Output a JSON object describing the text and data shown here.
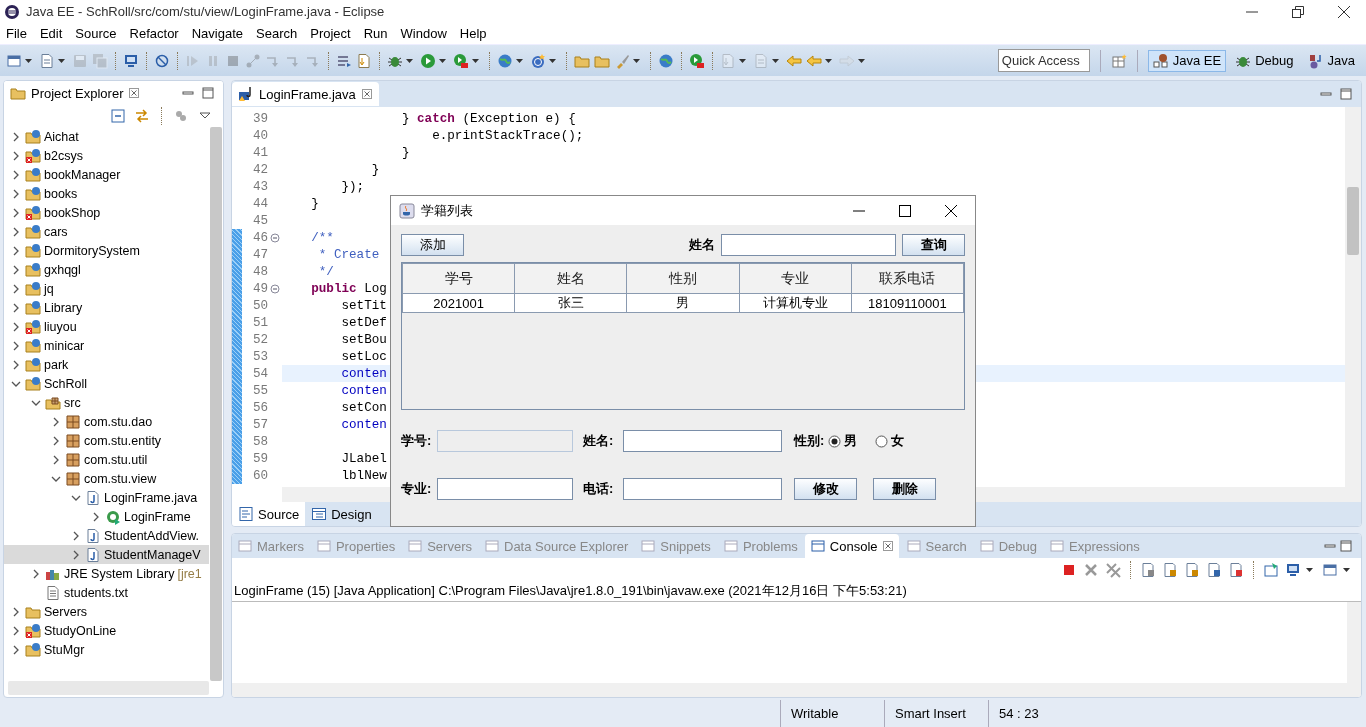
{
  "window": {
    "title": "Java EE - SchRoll/src/com/stu/view/LoginFrame.java - Eclipse"
  },
  "menu": [
    "File",
    "Edit",
    "Source",
    "Refactor",
    "Navigate",
    "Search",
    "Project",
    "Run",
    "Window",
    "Help"
  ],
  "toolbar": [
    {
      "kind": "window",
      "disabled": false,
      "dropdown": true
    },
    {
      "kind": "doc",
      "disabled": false,
      "dropdown": true
    },
    {
      "kind": "save",
      "disabled": true,
      "dropdown": false
    },
    {
      "kind": "saves",
      "disabled": true,
      "dropdown": false
    },
    {
      "kind": "sep"
    },
    {
      "kind": "monitor",
      "disabled": false,
      "dropdown": false
    },
    {
      "kind": "sep"
    },
    {
      "kind": "nosign",
      "disabled": false,
      "dropdown": false
    },
    {
      "kind": "sep"
    },
    {
      "kind": "play",
      "disabled": true,
      "dropdown": false
    },
    {
      "kind": "pause",
      "disabled": true,
      "dropdown": false
    },
    {
      "kind": "stop",
      "disabled": true,
      "dropdown": false
    },
    {
      "kind": "nodes",
      "disabled": true,
      "dropdown": false
    },
    {
      "kind": "step",
      "disabled": true,
      "dropdown": false
    },
    {
      "kind": "step",
      "disabled": true,
      "dropdown": false
    },
    {
      "kind": "step",
      "disabled": true,
      "dropdown": false
    },
    {
      "kind": "sep"
    },
    {
      "kind": "list",
      "disabled": false,
      "dropdown": false
    },
    {
      "kind": "docarrow",
      "disabled": false,
      "dropdown": false
    },
    {
      "kind": "sep"
    },
    {
      "kind": "bug",
      "disabled": false,
      "dropdown": true
    },
    {
      "kind": "run",
      "disabled": false,
      "dropdown": true
    },
    {
      "kind": "runserver",
      "disabled": false,
      "dropdown": true
    },
    {
      "kind": "sep"
    },
    {
      "kind": "globe",
      "disabled": false,
      "dropdown": true
    },
    {
      "kind": "coin",
      "disabled": false,
      "dropdown": true
    },
    {
      "kind": "sep"
    },
    {
      "kind": "folder",
      "disabled": false,
      "dropdown": false
    },
    {
      "kind": "folder",
      "disabled": false,
      "dropdown": false
    },
    {
      "kind": "brush",
      "disabled": false,
      "dropdown": true
    },
    {
      "kind": "sep"
    },
    {
      "kind": "globe",
      "disabled": false,
      "dropdown": false
    },
    {
      "kind": "sep"
    },
    {
      "kind": "runserver",
      "disabled": false,
      "dropdown": false
    },
    {
      "kind": "sep"
    },
    {
      "kind": "docarrow",
      "disabled": true,
      "dropdown": true
    },
    {
      "kind": "doc",
      "disabled": true,
      "dropdown": true
    },
    {
      "kind": "back",
      "disabled": false,
      "dropdown": false
    },
    {
      "kind": "back",
      "disabled": false,
      "dropdown": true
    },
    {
      "kind": "forward",
      "disabled": true,
      "dropdown": true
    }
  ],
  "quick_access": {
    "placeholder": "Quick Access"
  },
  "perspectives": [
    {
      "label": "Java EE",
      "selected": true
    },
    {
      "label": "Debug",
      "selected": false
    },
    {
      "label": "Java",
      "selected": false
    }
  ],
  "project_explorer": {
    "title": "Project Explorer",
    "tree": [
      {
        "label": "Aichat",
        "kind": "project",
        "error": false,
        "expanded": false,
        "selected": false
      },
      {
        "label": "b2csys",
        "kind": "project",
        "error": true,
        "expanded": false,
        "selected": false
      },
      {
        "label": "bookManager",
        "kind": "project",
        "error": false,
        "expanded": false,
        "selected": false
      },
      {
        "label": "books",
        "kind": "project",
        "error": false,
        "expanded": false,
        "selected": false
      },
      {
        "label": "bookShop",
        "kind": "project",
        "error": true,
        "expanded": false,
        "selected": false
      },
      {
        "label": "cars",
        "kind": "project",
        "error": false,
        "expanded": false,
        "selected": false
      },
      {
        "label": "DormitorySystem",
        "kind": "project",
        "error": false,
        "expanded": false,
        "selected": false
      },
      {
        "label": "gxhqgl",
        "kind": "project",
        "error": false,
        "expanded": false,
        "selected": false
      },
      {
        "label": "jq",
        "kind": "project",
        "error": false,
        "expanded": false,
        "selected": false
      },
      {
        "label": "Library",
        "kind": "project",
        "error": false,
        "expanded": false,
        "selected": false
      },
      {
        "label": "liuyou",
        "kind": "project",
        "error": true,
        "expanded": false,
        "selected": false
      },
      {
        "label": "minicar",
        "kind": "project",
        "error": false,
        "expanded": false,
        "selected": false
      },
      {
        "label": "park",
        "kind": "project",
        "error": false,
        "expanded": false,
        "selected": false
      },
      {
        "label": "SchRoll",
        "kind": "project",
        "error": false,
        "expanded": true,
        "selected": false,
        "children": [
          {
            "label": "src",
            "kind": "source-folder",
            "expanded": true,
            "selected": false,
            "children": [
              {
                "label": "com.stu.dao",
                "kind": "package",
                "expanded": false,
                "selected": false
              },
              {
                "label": "com.stu.entity",
                "kind": "package",
                "expanded": false,
                "selected": false
              },
              {
                "label": "com.stu.util",
                "kind": "package",
                "expanded": false,
                "selected": false
              },
              {
                "label": "com.stu.view",
                "kind": "package",
                "expanded": true,
                "selected": false,
                "children": [
                  {
                    "label": "LoginFrame.java",
                    "kind": "java-file",
                    "expanded": true,
                    "selected": false,
                    "children": [
                      {
                        "label": "LoginFrame",
                        "kind": "class",
                        "expanded": false,
                        "selected": false
                      }
                    ]
                  },
                  {
                    "label": "StudentAddView.",
                    "kind": "java-file",
                    "expanded": false,
                    "selected": false
                  },
                  {
                    "label": "StudentManageV",
                    "kind": "java-file",
                    "expanded": false,
                    "selected": true
                  }
                ]
              }
            ]
          },
          {
            "label": "JRE System Library",
            "decoration": "[jre1",
            "kind": "library",
            "expanded": false,
            "selected": false
          },
          {
            "label": "students.txt",
            "kind": "text-file",
            "selected": false
          }
        ]
      },
      {
        "label": "Servers",
        "kind": "folder",
        "expanded": false,
        "selected": false
      },
      {
        "label": "StudyOnLine",
        "kind": "project",
        "error": true,
        "expanded": false,
        "selected": false
      },
      {
        "label": "StuMgr",
        "kind": "project",
        "error": false,
        "expanded": false,
        "selected": false
      }
    ]
  },
  "editor": {
    "tab": "LoginFrame.java",
    "lines": [
      {
        "number": "39",
        "changed": false,
        "current": false,
        "fold": false,
        "segments": [
          {
            "text": "                } ",
            "kind": "plain"
          },
          {
            "text": "catch",
            "kind": "keyword"
          },
          {
            "text": " (Exception e) {",
            "kind": "plain"
          }
        ]
      },
      {
        "number": "40",
        "changed": false,
        "current": false,
        "fold": false,
        "segments": [
          {
            "text": "                    e.printStackTrace();",
            "kind": "plain"
          }
        ]
      },
      {
        "number": "41",
        "changed": false,
        "current": false,
        "fold": false,
        "segments": [
          {
            "text": "                }",
            "kind": "plain"
          }
        ]
      },
      {
        "number": "42",
        "changed": false,
        "current": false,
        "fold": false,
        "segments": [
          {
            "text": "            }",
            "kind": "plain"
          }
        ]
      },
      {
        "number": "43",
        "changed": false,
        "current": false,
        "fold": false,
        "segments": [
          {
            "text": "        });",
            "kind": "plain"
          }
        ]
      },
      {
        "number": "44",
        "changed": false,
        "current": false,
        "fold": false,
        "segments": [
          {
            "text": "    }",
            "kind": "plain"
          }
        ]
      },
      {
        "number": "45",
        "changed": false,
        "current": false,
        "fold": false
      },
      {
        "number": "46",
        "changed": true,
        "current": false,
        "fold": true,
        "segments": [
          {
            "text": "    /**",
            "kind": "comment"
          }
        ]
      },
      {
        "number": "47",
        "changed": true,
        "current": false,
        "fold": false,
        "segments": [
          {
            "text": "     * Create",
            "kind": "comment"
          }
        ]
      },
      {
        "number": "48",
        "changed": true,
        "current": false,
        "fold": false,
        "segments": [
          {
            "text": "     */",
            "kind": "comment"
          }
        ]
      },
      {
        "number": "49",
        "changed": true,
        "current": false,
        "fold": true,
        "segments": [
          {
            "text": "    public",
            "kind": "keyword"
          },
          {
            "text": " Log",
            "kind": "plain"
          }
        ]
      },
      {
        "number": "50",
        "changed": true,
        "current": false,
        "fold": false,
        "segments": [
          {
            "text": "        setTit",
            "kind": "plain"
          }
        ]
      },
      {
        "number": "51",
        "changed": true,
        "current": false,
        "fold": false,
        "segments": [
          {
            "text": "        setDef",
            "kind": "plain"
          }
        ]
      },
      {
        "number": "52",
        "changed": true,
        "current": false,
        "fold": false,
        "segments": [
          {
            "text": "        setBou",
            "kind": "plain"
          }
        ]
      },
      {
        "number": "53",
        "changed": true,
        "current": false,
        "fold": false,
        "segments": [
          {
            "text": "        setLoc",
            "kind": "plain"
          }
        ]
      },
      {
        "number": "54",
        "changed": true,
        "current": true,
        "fold": false,
        "segments": [
          {
            "text": "        conten",
            "kind": "field"
          }
        ]
      },
      {
        "number": "55",
        "changed": true,
        "current": false,
        "fold": false,
        "segments": [
          {
            "text": "        conten",
            "kind": "field"
          }
        ]
      },
      {
        "number": "56",
        "changed": true,
        "current": false,
        "fold": false,
        "segments": [
          {
            "text": "        setCon",
            "kind": "plain"
          }
        ]
      },
      {
        "number": "57",
        "changed": true,
        "current": false,
        "fold": false,
        "segments": [
          {
            "text": "        conten",
            "kind": "field"
          }
        ]
      },
      {
        "number": "58",
        "changed": true,
        "current": false,
        "fold": false
      },
      {
        "number": "59",
        "changed": true,
        "current": false,
        "fold": false,
        "segments": [
          {
            "text": "        JLabel",
            "kind": "plain"
          }
        ]
      },
      {
        "number": "60",
        "changed": true,
        "current": false,
        "fold": false,
        "segments": [
          {
            "text": "        lblNew",
            "kind": "plain"
          }
        ]
      }
    ],
    "bottom_tabs": [
      {
        "label": "Source",
        "selected": true
      },
      {
        "label": "Design",
        "selected": false
      }
    ]
  },
  "console_panel": {
    "tabs": [
      {
        "label": "Markers",
        "selected": false
      },
      {
        "label": "Properties",
        "selected": false
      },
      {
        "label": "Servers",
        "selected": false
      },
      {
        "label": "Data Source Explorer",
        "selected": false
      },
      {
        "label": "Snippets",
        "selected": false
      },
      {
        "label": "Problems",
        "selected": false
      },
      {
        "label": "Console",
        "selected": true
      },
      {
        "label": "Search",
        "selected": false
      },
      {
        "label": "Debug",
        "selected": false
      },
      {
        "label": "Expressions",
        "selected": false
      }
    ],
    "text": "LoginFrame (15) [Java Application] C:\\Program Files\\Java\\jre1.8.0_191\\bin\\javaw.exe (2021年12月16日 下午5:53:21)"
  },
  "status_bar": [
    "Writable",
    "Smart Insert",
    "54 : 23"
  ],
  "dialog": {
    "title": "学籍列表",
    "add_button": "添加",
    "search_label": "姓名",
    "search_button": "查询",
    "table": {
      "columns": [
        "学号",
        "姓名",
        "性别",
        "专业",
        "联系电话"
      ],
      "rows": [
        [
          "2021001",
          "张三",
          "男",
          "计算机专业",
          "18109110001"
        ]
      ]
    },
    "fields": [
      {
        "label": "学号:",
        "disabled": true
      },
      {
        "label": "姓名:",
        "disabled": false
      }
    ],
    "gender": {
      "label": "性别:",
      "options": [
        {
          "label": "男",
          "selected": true
        },
        {
          "label": "女",
          "selected": false
        }
      ]
    },
    "fields2": [
      {
        "label": "专业:",
        "disabled": false
      },
      {
        "label": "电话:",
        "disabled": false
      }
    ],
    "buttons": [
      "修改",
      "删除"
    ]
  }
}
